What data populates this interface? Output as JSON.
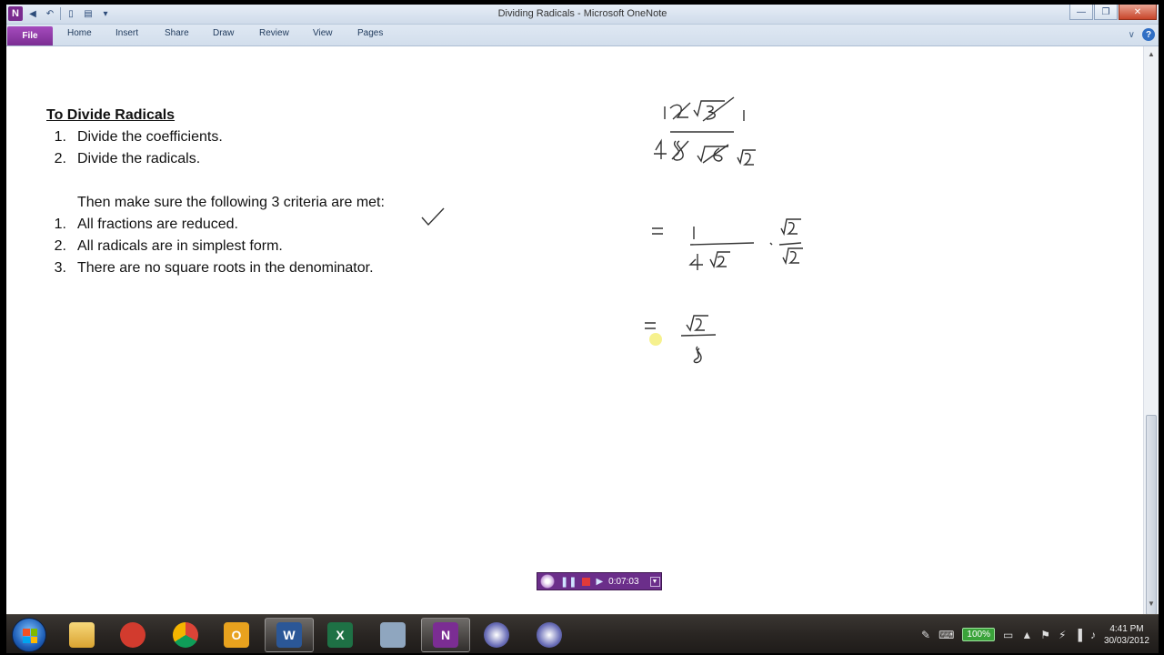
{
  "window": {
    "title": "Dividing Radicals - Microsoft OneNote",
    "app_icon_letter": "N"
  },
  "ribbon": {
    "file_tab": "File",
    "tabs": [
      "Home",
      "Insert",
      "Share",
      "Draw",
      "Review",
      "View",
      "Pages"
    ]
  },
  "note": {
    "heading": "To Divide Radicals",
    "steps": [
      {
        "num": "1.",
        "text": "Divide the coefficients."
      },
      {
        "num": "2.",
        "text": "Divide the radicals."
      }
    ],
    "criteria_intro": "Then make sure the following 3 criteria are met:",
    "criteria": [
      {
        "num": "1.",
        "text": "All fractions are reduced."
      },
      {
        "num": "2.",
        "text": "All radicals are in simplest form."
      },
      {
        "num": "3.",
        "text": "There are no square roots in the denominator."
      }
    ]
  },
  "recorder": {
    "time": "0:07:03"
  },
  "taskbar": {
    "battery": "100%",
    "time": "4:41 PM",
    "date": "30/03/2012"
  },
  "colors": {
    "onenote_purple": "#7b2d93",
    "titlebar": "#dfe8f3",
    "taskbar": "#2a2623"
  }
}
